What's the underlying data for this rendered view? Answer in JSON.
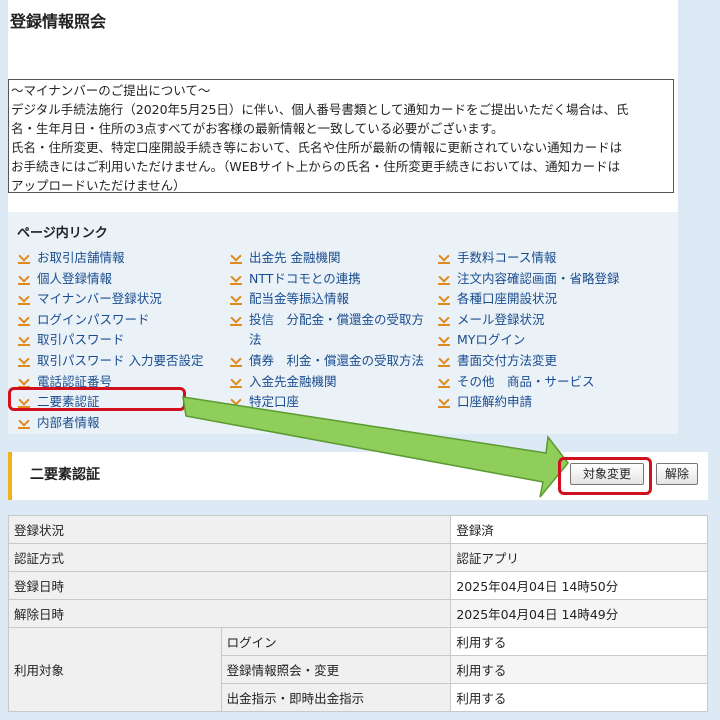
{
  "page": {
    "title": "登録情報照会"
  },
  "notice": {
    "lines": [
      "～マイナンバーのご提出について～",
      "デジタル手続法施行（2020年5月25日）に伴い、個人番号書類として通知カードをご提出いただく場合は、氏",
      "名・生年月日・住所の3点すべてがお客様の最新情報と一致している必要がございます。",
      "氏名・住所変更、特定口座開設手続き等において、氏名や住所が最新の情報に更新されていない通知カードは",
      "お手続きにはご利用いただけません。（WEBサイト上からの氏名・住所変更手続きにおいては、通知カードは",
      "アップロードいただけません）"
    ]
  },
  "links": {
    "heading": "ページ内リンク",
    "col1": [
      "お取引店舗情報",
      "個人登録情報",
      "マイナンバー登録状況",
      "ログインパスワード",
      "取引パスワード",
      "取引パスワード 入力要否設定",
      "電話認証番号",
      "二要素認証",
      "内部者情報"
    ],
    "col2": [
      "出金先 金融機関",
      "NTTドコモとの連携",
      "配当金等振込情報",
      "投信　分配金・償還金の受取方",
      "法",
      "債券　利金・償還金の受取方法",
      "入金先金融機関",
      "特定口座"
    ],
    "col3": [
      "手数料コース情報",
      "注文内容確認画面・省略登録",
      "各種口座開設状況",
      "メール登録状況",
      "MYログイン",
      "書面交付方法変更",
      "その他　商品・サービス",
      "口座解約申請"
    ]
  },
  "section": {
    "title": "二要素認証",
    "change_button": "対象変更",
    "release_button": "解除"
  },
  "table": {
    "rows": [
      {
        "label": "登録状況",
        "value": "登録済"
      },
      {
        "label": "認証方式",
        "value": "認証アプリ"
      },
      {
        "label": "登録日時",
        "value": "2025年04月04日 14時50分"
      },
      {
        "label": "解除日時",
        "value": "2025年04月04日 14時49分"
      }
    ],
    "target_label": "利用対象",
    "targets": [
      {
        "label": "ログイン",
        "value": "利用する"
      },
      {
        "label": "登録情報照会・変更",
        "value": "利用する"
      },
      {
        "label": "出金指示・即時出金指示",
        "value": "利用する"
      }
    ]
  },
  "colors": {
    "highlight": "#d0101e",
    "arrow": "#8fce5a",
    "link": "#1a4d8f",
    "accent": "#f0b41e"
  }
}
